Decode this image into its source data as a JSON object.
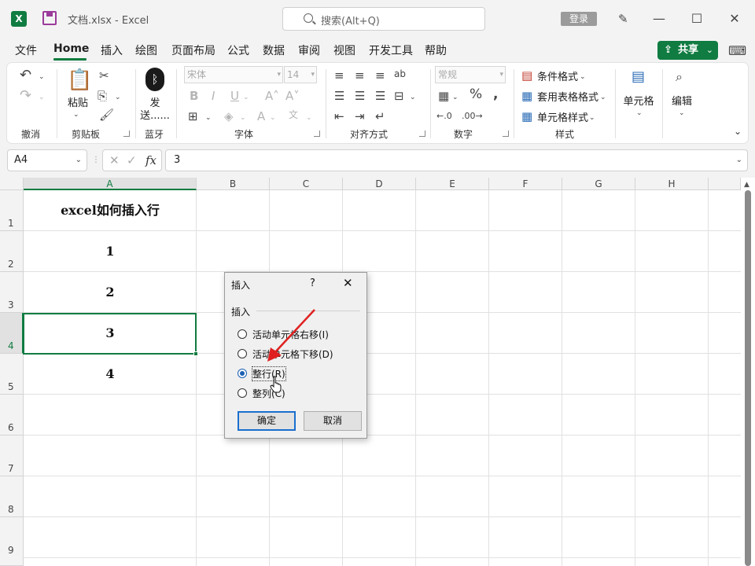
{
  "titlebar": {
    "app_icon": "excel-icon",
    "title": "文档.xlsx  -  Excel",
    "search_placeholder": "搜索(Alt+Q)",
    "login": "登录"
  },
  "tabs": [
    "文件",
    "Home",
    "插入",
    "绘图",
    "页面布局",
    "公式",
    "数据",
    "审阅",
    "视图",
    "开发工具",
    "帮助"
  ],
  "active_tab": "Home",
  "share_label": "共享",
  "ribbon": {
    "undo_group": "撤消",
    "clipboard_group": "剪贴板",
    "paste_label": "粘贴",
    "bluetooth_label1": "发",
    "bluetooth_label2": "送......",
    "bluetooth_group": "蓝牙",
    "font_name": "宋体",
    "font_size": "14",
    "font_group": "字体",
    "align_group": "对齐方式",
    "number_format": "常规",
    "number_group": "数字",
    "cond_format": "条件格式",
    "table_format": "套用表格格式",
    "cell_style": "单元格样式",
    "style_group": "样式",
    "cells_label": "单元格",
    "edit_label": "编辑"
  },
  "formula_bar": {
    "name_box": "A4",
    "fx": "fx",
    "value": "3"
  },
  "columns": [
    "A",
    "B",
    "C",
    "D",
    "E",
    "F",
    "G",
    "H"
  ],
  "rows": [
    "1",
    "2",
    "3",
    "4",
    "5",
    "6",
    "7",
    "8",
    "9"
  ],
  "cells": {
    "A1": "excel如何插入行",
    "A2": "1",
    "A3": "2",
    "A4": "3",
    "A5": "4"
  },
  "dialog": {
    "title": "插入",
    "help": "?",
    "group_label": "插入",
    "options": [
      "活动单元格右移(I)",
      "活动单元格下移(D)",
      "整行(R)",
      "整列(C)"
    ],
    "selected_option": "整行(R)",
    "ok": "确定",
    "cancel": "取消"
  },
  "colors": {
    "accent": "#107c41",
    "arrow": "#e02020"
  }
}
